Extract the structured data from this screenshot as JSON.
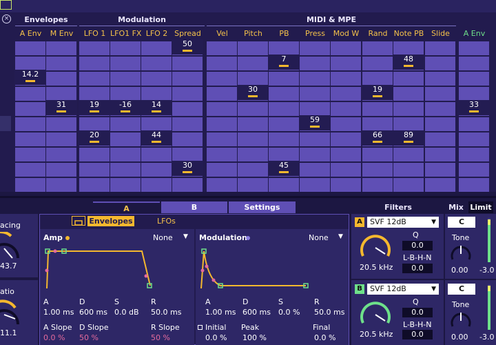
{
  "matrix": {
    "close_glyph": "×",
    "groups": [
      {
        "label": "Envelopes"
      },
      {
        "label": "Modulation"
      },
      {
        "label": "MIDI & MPE"
      }
    ],
    "columns": [
      {
        "label": "A Env"
      },
      {
        "label": "M Env"
      },
      {
        "label": "LFO 1"
      },
      {
        "label": "LFO1 FX"
      },
      {
        "label": "LFO 2"
      },
      {
        "label": "Spread"
      },
      {
        "label": "Vel"
      },
      {
        "label": "Pitch"
      },
      {
        "label": "PB"
      },
      {
        "label": "Press"
      },
      {
        "label": "Mod W"
      },
      {
        "label": "Rand"
      },
      {
        "label": "Note PB"
      },
      {
        "label": "Slide"
      },
      {
        "label": "A Env"
      }
    ],
    "values": [
      {
        "col": 5,
        "row": 0,
        "text": "50"
      },
      {
        "col": 8,
        "row": 1,
        "text": "7"
      },
      {
        "col": 12,
        "row": 1,
        "text": "48"
      },
      {
        "col": 0,
        "row": 2,
        "text": "14.2"
      },
      {
        "col": 7,
        "row": 3,
        "text": "30"
      },
      {
        "col": 11,
        "row": 3,
        "text": "19"
      },
      {
        "col": 1,
        "row": 4,
        "text": "31"
      },
      {
        "col": 2,
        "row": 4,
        "text": "19"
      },
      {
        "col": 3,
        "row": 4,
        "text": "-16"
      },
      {
        "col": 4,
        "row": 4,
        "text": "14"
      },
      {
        "col": 14,
        "row": 4,
        "text": "33"
      },
      {
        "col": 9,
        "row": 5,
        "text": "59"
      },
      {
        "col": 2,
        "row": 6,
        "text": "20"
      },
      {
        "col": 4,
        "row": 6,
        "text": "44"
      },
      {
        "col": 11,
        "row": 6,
        "text": "66"
      },
      {
        "col": 12,
        "row": 6,
        "text": "89"
      },
      {
        "col": 5,
        "row": 8,
        "text": "30"
      },
      {
        "col": 8,
        "row": 8,
        "text": "45"
      }
    ]
  },
  "tabs": {
    "a": "A",
    "b": "B",
    "settings": "Settings",
    "filters": "Filters",
    "mix": "Mix",
    "limit": "Limit"
  },
  "left": {
    "spacing_label": "acing",
    "spacing_value": "43.7",
    "ratio_label": "atio",
    "ratio_value": "11.1"
  },
  "envelope_tabs": {
    "envelopes": "Envelopes",
    "lfos": "LFOs"
  },
  "amp": {
    "title": "Amp",
    "target": "None",
    "params": [
      {
        "label": "A",
        "value": "1.00 ms"
      },
      {
        "label": "D",
        "value": "600 ms"
      },
      {
        "label": "S",
        "value": "0.0 dB"
      },
      {
        "label": "R",
        "value": "50.0 ms"
      }
    ],
    "slopes": [
      {
        "label": "A Slope",
        "value": "0.0 %"
      },
      {
        "label": "D Slope",
        "value": "50 %"
      },
      {
        "label": "R Slope",
        "value": "50 %"
      }
    ]
  },
  "modulation": {
    "title": "Modulation",
    "target": "None",
    "params": [
      {
        "label": "A",
        "value": "1.00 ms"
      },
      {
        "label": "D",
        "value": "600 ms"
      },
      {
        "label": "S",
        "value": "0.0 %"
      },
      {
        "label": "R",
        "value": "50.0 ms"
      }
    ],
    "extra": [
      {
        "label": "Initial",
        "value": "0.0 %"
      },
      {
        "label": "Peak",
        "value": "100 %"
      },
      {
        "label": "Final",
        "value": "0.0 %"
      }
    ]
  },
  "filter_a": {
    "letter": "A",
    "type": "SVF 12dB",
    "freq": "20.5 kHz",
    "q_label": "Q",
    "q_value": "0.0",
    "mode_label": "L-B-H-N",
    "mode_value": "0.0"
  },
  "filter_b": {
    "letter": "B",
    "type": "SVF 12dB",
    "freq": "20.5 kHz",
    "q_label": "Q",
    "q_value": "0.0",
    "mode_label": "L-B-H-N",
    "mode_value": "0.0"
  },
  "mix_a": {
    "channel": "C",
    "tone_label": "Tone",
    "tone_value": "0.00",
    "level": "-3.0"
  },
  "mix_b": {
    "channel": "C",
    "tone_label": "Tone",
    "tone_value": "0.00",
    "level": "-3.0"
  },
  "colors": {
    "accent_orange": "#f5b82e",
    "accent_green": "#6ee08a",
    "cell": "#5f4fb5",
    "panel": "#2e2766"
  }
}
